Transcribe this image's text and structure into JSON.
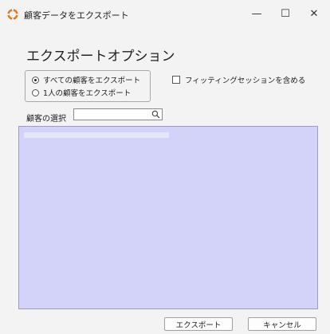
{
  "window": {
    "title": "顧客データをエクスポート",
    "minimize_glyph": "—",
    "maximize_glyph": "☐",
    "close_glyph": "✕"
  },
  "main": {
    "heading": "エクスポートオプション",
    "options": [
      {
        "label": "すべての顧客をエクスポート",
        "selected": true
      },
      {
        "label": "1人の顧客をエクスポート",
        "selected": false
      }
    ],
    "include_fitting_sessions": {
      "label": "フィッティングセッションを含める",
      "checked": false
    },
    "search": {
      "label": "顧客の選択",
      "value": "",
      "placeholder": ""
    }
  },
  "buttons": {
    "export": "エクスポート",
    "cancel": "キャンセル"
  },
  "colors": {
    "list_background": "#d3d3fa",
    "app_icon_accent": "#e07a1f"
  }
}
